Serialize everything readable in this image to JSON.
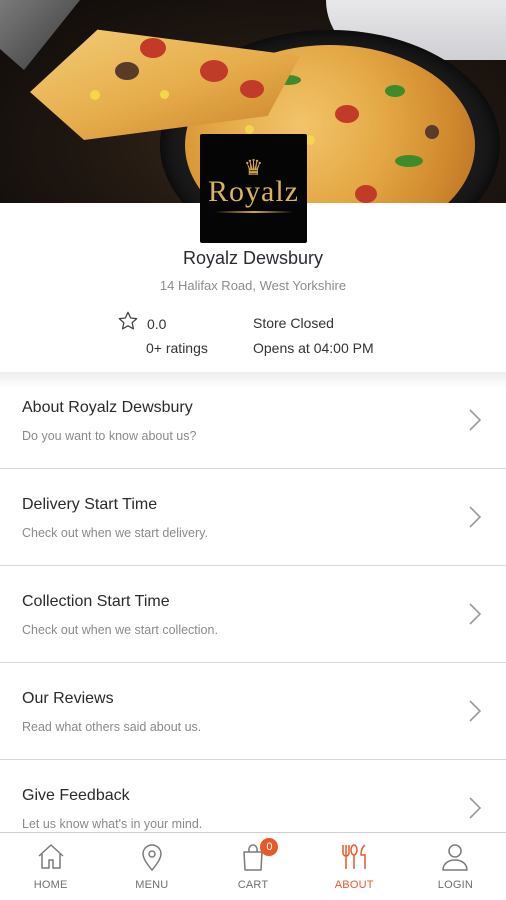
{
  "store": {
    "logo_text": "Royalz",
    "name": "Royalz Dewsbury",
    "address": "14 Halifax Road, West Yorkshire",
    "rating": "0.0",
    "ratings_count": "0+ ratings",
    "status": "Store Closed",
    "opens_at": "Opens at 04:00 PM"
  },
  "menu": {
    "items": [
      {
        "title": "About Royalz Dewsbury",
        "desc": "Do you want to know about us?"
      },
      {
        "title": "Delivery Start Time",
        "desc": "Check out when we start delivery."
      },
      {
        "title": "Collection Start Time",
        "desc": "Check out when we start collection."
      },
      {
        "title": "Our Reviews",
        "desc": "Read what others said about us."
      },
      {
        "title": "Give Feedback",
        "desc": "Let us know what's in your mind."
      }
    ]
  },
  "nav": {
    "home": "HOME",
    "menu": "MENU",
    "cart": "CART",
    "cart_count": "0",
    "about": "ABOUT",
    "login": "LOGIN",
    "active": "about"
  },
  "colors": {
    "accent": "#e8592a",
    "logo_gold": "#d9b45a",
    "logo_bg": "#050505"
  },
  "icons": {
    "home": "home-icon",
    "menu": "location-pin-icon",
    "cart": "shopping-bag-icon",
    "about": "cutlery-icon",
    "login": "user-icon",
    "rating": "star-outline-icon",
    "item": "chevron-right-icon"
  }
}
